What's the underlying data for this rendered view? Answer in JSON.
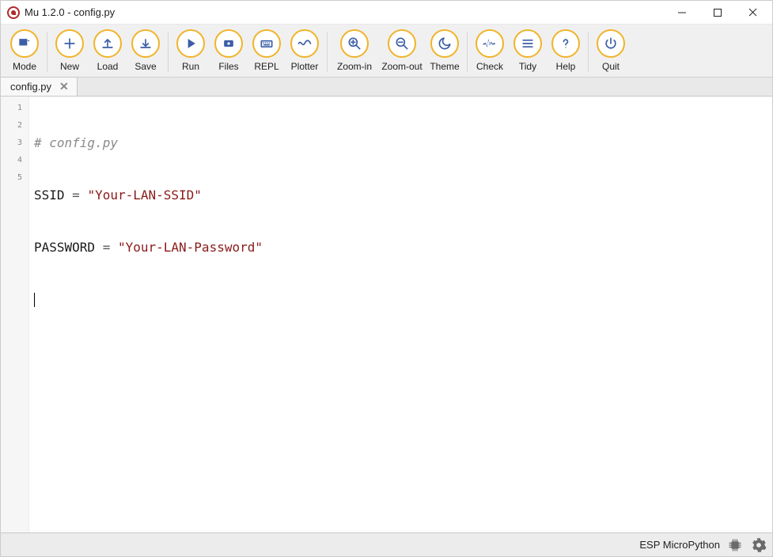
{
  "window": {
    "title": "Mu 1.2.0 - config.py"
  },
  "toolbar": {
    "mode": "Mode",
    "new": "New",
    "load": "Load",
    "save": "Save",
    "run": "Run",
    "files": "Files",
    "repl": "REPL",
    "plotter": "Plotter",
    "zoom_in": "Zoom-in",
    "zoom_out": "Zoom-out",
    "theme": "Theme",
    "check": "Check",
    "tidy": "Tidy",
    "help": "Help",
    "quit": "Quit"
  },
  "tab": {
    "name": "config.py"
  },
  "editor": {
    "lines": [
      "1",
      "2",
      "3",
      "4",
      "5"
    ],
    "l1_comment": "# config.py",
    "l2_ident": "SSID",
    "l2_eq": " = ",
    "l2_str": "\"Your-LAN-SSID\"",
    "l3_ident": "PASSWORD",
    "l3_eq": " = ",
    "l3_str": "\"Your-LAN-Password\""
  },
  "status": {
    "mode": "ESP MicroPython"
  }
}
